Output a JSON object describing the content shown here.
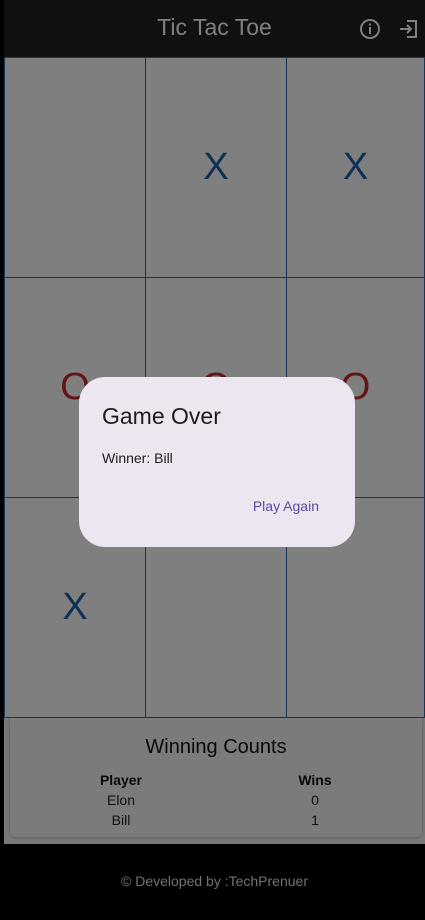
{
  "app_bar": {
    "title": "Tic Tac Toe",
    "info_icon": "info-icon",
    "exit_icon": "logout-icon"
  },
  "board": {
    "cells": [
      "",
      "X",
      "X",
      "O",
      "O",
      "O",
      "X",
      "",
      ""
    ]
  },
  "winning_counts": {
    "title": "Winning Counts",
    "headers": {
      "player": "Player",
      "wins": "Wins"
    },
    "rows": [
      {
        "player": "Elon",
        "wins": "0"
      },
      {
        "player": "Bill",
        "wins": "1"
      }
    ]
  },
  "footer": {
    "text": "© Developed by :TechPrenuer"
  },
  "dialog": {
    "title": "Game Over",
    "message": "Winner: Bill",
    "action_label": "Play Again"
  },
  "colors": {
    "x_mark": "#1f5ea8",
    "o_mark": "#c62828",
    "grid_line": "#2b6cb0",
    "app_bar": "#212121",
    "dialog_bg": "#ece6f0",
    "dialog_action": "#5b4a9e"
  }
}
